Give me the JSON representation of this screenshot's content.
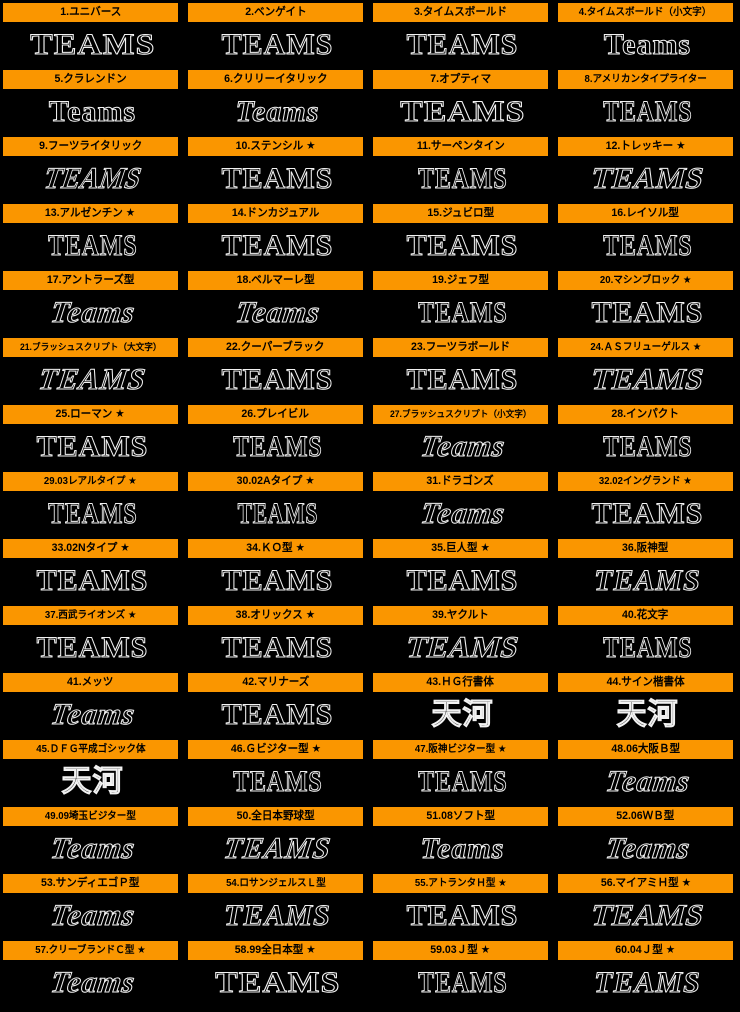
{
  "page": {
    "background_color": "#000000",
    "label_bar_color": "#FA9600",
    "label_text_color": "#000000",
    "sample_outline_color": "#F2F2F2",
    "columns": 4,
    "rows": 15,
    "total_items": 60
  },
  "items": [
    {
      "no": "1",
      "label": "1.ユニバース",
      "sample": "TEAMS"
    },
    {
      "no": "2",
      "label": "2.ベンゲイト",
      "sample": "TEAMS"
    },
    {
      "no": "3",
      "label": "3.タイムスボールド",
      "sample": "TEAMS"
    },
    {
      "no": "4",
      "label": "4.タイムスボールド（小文字）",
      "sample": "Teams"
    },
    {
      "no": "5",
      "label": "5.クラレンドン",
      "sample": "Teams"
    },
    {
      "no": "6",
      "label": "6.クリリーイタリック",
      "sample": "Teams"
    },
    {
      "no": "7",
      "label": "7.オプティマ",
      "sample": "TEAMS"
    },
    {
      "no": "8",
      "label": "8.アメリカンタイプライター",
      "sample": "TEAMS"
    },
    {
      "no": "9",
      "label": "9.フーツライタリック",
      "sample": "TEAMS"
    },
    {
      "no": "10",
      "label": "10.ステンシル ★",
      "sample": "TEAMS"
    },
    {
      "no": "11",
      "label": "11.サーペンタイン",
      "sample": "TEAMS"
    },
    {
      "no": "12",
      "label": "12.トレッキー ★",
      "sample": "TEAMS"
    },
    {
      "no": "13",
      "label": "13.アルゼンチン ★",
      "sample": "TEAMS"
    },
    {
      "no": "14",
      "label": "14.ドンカジュアル",
      "sample": "TEAMS"
    },
    {
      "no": "15",
      "label": "15.ジュビロ型",
      "sample": "TEAMS"
    },
    {
      "no": "16",
      "label": "16.レイソル型",
      "sample": "TEAMS"
    },
    {
      "no": "17",
      "label": "17.アントラーズ型",
      "sample": "Teams"
    },
    {
      "no": "18",
      "label": "18.ベルマーレ型",
      "sample": "Teams"
    },
    {
      "no": "19",
      "label": "19.ジェフ型",
      "sample": "TEAMS"
    },
    {
      "no": "20",
      "label": "20.マシンブロック ★",
      "sample": "TEAMS"
    },
    {
      "no": "21",
      "label": "21.ブラッシュスクリプト（大文字）",
      "sample": "TEAMS"
    },
    {
      "no": "22",
      "label": "22.クーパーブラック",
      "sample": "TEAMS"
    },
    {
      "no": "23",
      "label": "23.フーツラボールド",
      "sample": "TEAMS"
    },
    {
      "no": "24",
      "label": "24.ＡＳフリューゲルス ★",
      "sample": "TEAMS"
    },
    {
      "no": "25",
      "label": "25.ローマン ★",
      "sample": "TEAMS"
    },
    {
      "no": "26",
      "label": "26.プレイビル",
      "sample": "TEAMS"
    },
    {
      "no": "27",
      "label": "27.ブラッシュスクリプト（小文字）",
      "sample": "Teams"
    },
    {
      "no": "28",
      "label": "28.インパクト",
      "sample": "TEAMS"
    },
    {
      "no": "29",
      "label": "29.03レアルタイプ ★",
      "sample": "TEAMS"
    },
    {
      "no": "30",
      "label": "30.02Aタイプ ★",
      "sample": "TEAMS"
    },
    {
      "no": "31",
      "label": "31.ドラゴンズ",
      "sample": "Teams"
    },
    {
      "no": "32",
      "label": "32.02イングランド ★",
      "sample": "TEAMS"
    },
    {
      "no": "33",
      "label": "33.02Nタイプ ★",
      "sample": "TEAMS"
    },
    {
      "no": "34",
      "label": "34.ＫＯ型 ★",
      "sample": "TEAMS"
    },
    {
      "no": "35",
      "label": "35.巨人型 ★",
      "sample": "TEAMS"
    },
    {
      "no": "36",
      "label": "36.阪神型",
      "sample": "TEAMS"
    },
    {
      "no": "37",
      "label": "37.西武ライオンズ ★",
      "sample": "TEAMS"
    },
    {
      "no": "38",
      "label": "38.オリックス ★",
      "sample": "TEAMS"
    },
    {
      "no": "39",
      "label": "39.ヤクルト",
      "sample": "TEAMS"
    },
    {
      "no": "40",
      "label": "40.花文字",
      "sample": "TEAMS"
    },
    {
      "no": "41",
      "label": "41.メッツ",
      "sample": "Teams"
    },
    {
      "no": "42",
      "label": "42.マリナーズ",
      "sample": "TEAMS"
    },
    {
      "no": "43",
      "label": "43.ＨＧ行書体",
      "sample": "天河"
    },
    {
      "no": "44",
      "label": "44.サイン楷書体",
      "sample": "天河"
    },
    {
      "no": "45",
      "label": "45.ＤＦＧ平成ゴシック体",
      "sample": "天河"
    },
    {
      "no": "46",
      "label": "46.Ｇビジター型 ★",
      "sample": "TEAMS"
    },
    {
      "no": "47",
      "label": "47.阪神ビジター型 ★",
      "sample": "TEAMS"
    },
    {
      "no": "48",
      "label": "48.06大阪Ｂ型",
      "sample": "Teams"
    },
    {
      "no": "49",
      "label": "49.09埼玉ビジター型",
      "sample": "Teams"
    },
    {
      "no": "50",
      "label": "50.全日本野球型",
      "sample": "TEAMS"
    },
    {
      "no": "51",
      "label": "51.08ソフト型",
      "sample": "Teams"
    },
    {
      "no": "52",
      "label": "52.06ＷＢ型",
      "sample": "Teams"
    },
    {
      "no": "53",
      "label": "53.サンディエゴＰ型",
      "sample": "Teams"
    },
    {
      "no": "54",
      "label": "54.ロサンジェルスＬ型",
      "sample": "TEAMS"
    },
    {
      "no": "55",
      "label": "55.アトランタＨ型 ★",
      "sample": "TEAMS"
    },
    {
      "no": "56",
      "label": "56.マイアミＨ型 ★",
      "sample": "TEAMS"
    },
    {
      "no": "57",
      "label": "57.クリーブランドＣ型 ★",
      "sample": "Teams"
    },
    {
      "no": "58",
      "label": "58.99全日本型 ★",
      "sample": "TEAMS"
    },
    {
      "no": "59",
      "label": "59.03Ｊ型 ★",
      "sample": "TEAMS"
    },
    {
      "no": "60",
      "label": "60.04Ｊ型 ★",
      "sample": "TEAMS"
    }
  ]
}
